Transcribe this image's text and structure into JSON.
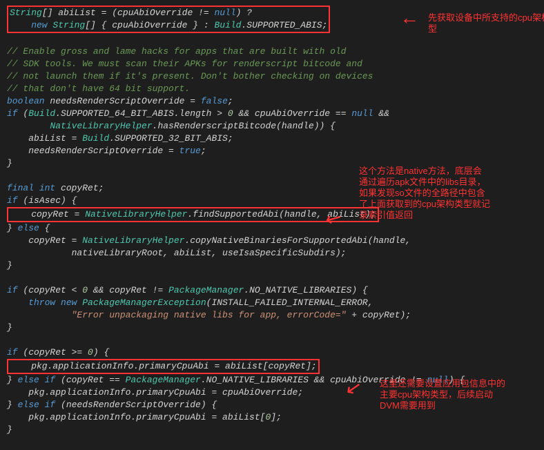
{
  "code": {
    "l1a": "String",
    "l1b": "[] abiList = (cpuAbiOverride != ",
    "l1c": "null",
    "l1d": ") ?",
    "l2a": "    new ",
    "l2b": "String",
    "l2c": "[] { cpuAbiOverride } : ",
    "l2d": "Build",
    "l2e": ".SUPPORTED_ABIS;",
    "c1": "// Enable gross and lame hacks for apps that are built with old",
    "c2": "// SDK tools. We must scan their APKs for renderscript bitcode and",
    "c3": "// not launch them if it's present. Don't bother checking on devices",
    "c4": "// that don't have 64 bit support.",
    "l5a": "boolean",
    "l5b": " needsRenderScriptOverride = ",
    "l5c": "false",
    "l5d": ";",
    "l6a": "if",
    "l6b": " (",
    "l6c": "Build",
    "l6d": ".SUPPORTED_64_BIT_ABIS.length > ",
    "l6e": "0",
    "l6f": " && cpuAbiOverride == ",
    "l6g": "null",
    "l6h": " &&",
    "l7a": "        ",
    "l7b": "NativeLibraryHelper",
    "l7c": ".hasRenderscriptBitcode(handle)) {",
    "l8a": "    abiList = ",
    "l8b": "Build",
    "l8c": ".SUPPORTED_32_BIT_ABIS;",
    "l9a": "    needsRenderScriptOverride = ",
    "l9b": "true",
    "l9c": ";",
    "l10": "}",
    "l12a": "final ",
    "l12b": "int",
    "l12c": " copyRet;",
    "l13a": "if",
    "l13b": " (isAsec) {",
    "l14a": "    copyRet = ",
    "l14b": "NativeLibraryHelper",
    "l14c": ".findSupportedAbi(handle, abiList);",
    "l15a": "} ",
    "l15b": "else",
    "l15c": " {",
    "l16a": "    copyRet = ",
    "l16b": "NativeLibraryHelper",
    "l16c": ".copyNativeBinariesForSupportedAbi(handle,",
    "l17": "            nativeLibraryRoot, abiList, useIsaSpecificSubdirs);",
    "l18": "}",
    "l20a": "if",
    "l20b": " (copyRet < ",
    "l20c": "0",
    "l20d": " && copyRet != ",
    "l20e": "PackageManager",
    "l20f": ".NO_NATIVE_LIBRARIES) {",
    "l21a": "    throw new ",
    "l21b": "PackageManagerException",
    "l21c": "(INSTALL_FAILED_INTERNAL_ERROR,",
    "l22a": "            ",
    "l22b": "\"Error unpackaging native libs for app, errorCode=\"",
    "l22c": " + copyRet);",
    "l23": "}",
    "l25a": "if",
    "l25b": " (copyRet >= ",
    "l25c": "0",
    "l25d": ") {",
    "l26a": "    pkg.applicationInfo.primaryCpuAbi = abiList[copyRet];",
    "l27a": "} ",
    "l27b": "else if",
    "l27c": " (copyRet == ",
    "l27d": "PackageManager",
    "l27e": ".NO_NATIVE_LIBRARIES && cpuAbiOverride != ",
    "l27f": "null",
    "l27g": ") {",
    "l28": "    pkg.applicationInfo.primaryCpuAbi = cpuAbiOverride;",
    "l29a": "} ",
    "l29b": "else if",
    "l29c": " (needsRenderScriptOverride) {",
    "l30a": "    pkg.applicationInfo.primaryCpuAbi = abiList[",
    "l30b": "0",
    "l30c": "];",
    "l31": "}"
  },
  "notes": {
    "n1": "先获取设备中所支持的cpu架构类型",
    "n2": "这个方法是native方法，底层会通过遍历apk文件中的libs目录，如果发现so文件的全路径中包含了上面获取到的cpu架构类型就记录索引值返回",
    "n3": "这里还需要设置应用包信息中的主要cpu架构类型，后续启动DVM需要用到"
  }
}
